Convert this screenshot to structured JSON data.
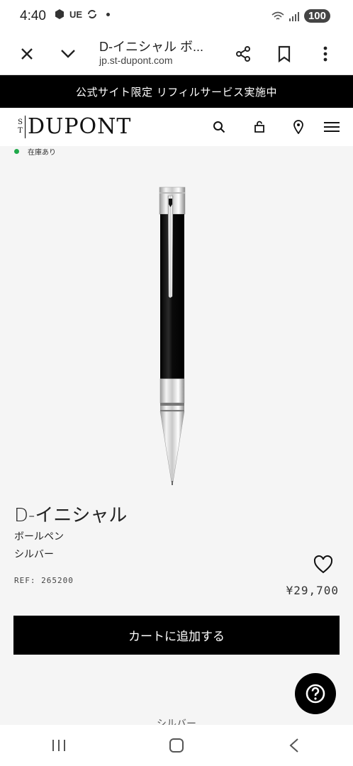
{
  "status": {
    "time": "4:40",
    "carrier": "UE",
    "battery": "100"
  },
  "browser": {
    "title": "D-イニシャル ボ...",
    "url": "jp.st-dupont.com"
  },
  "announcement": "公式サイト限定 リフィルサービス実施中",
  "brand": {
    "st_top": "S",
    "st_bottom": "T",
    "name": "DUPONT"
  },
  "product": {
    "stock": "在庫あり",
    "name": "D-イニシャル",
    "type": "ボールペン",
    "color": "シルバー",
    "ref": "REF: 265200",
    "price": "¥29,700",
    "add_to_cart": "カートに追加する",
    "next_section_label": "シルバー"
  },
  "colors": {
    "stock_indicator": "#1fa94a",
    "primary": "#000000"
  },
  "icons": [
    "close-icon",
    "chevron-down-icon",
    "share-icon",
    "bookmark-icon",
    "more-icon",
    "search-icon",
    "bag-icon",
    "location-icon",
    "menu-icon",
    "heart-icon",
    "help-icon"
  ]
}
